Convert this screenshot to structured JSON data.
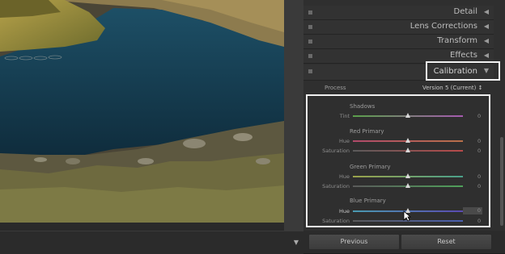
{
  "panel_sections": [
    {
      "title": "Detail"
    },
    {
      "title": "Lens Corrections"
    },
    {
      "title": "Transform"
    },
    {
      "title": "Effects"
    }
  ],
  "calibration": {
    "title": "Calibration",
    "process_label": "Process",
    "process_value": "Version 5 (Current) ↕",
    "shadows_title": "Shadows",
    "red_title": "Red Primary",
    "green_title": "Green Primary",
    "blue_title": "Blue Primary",
    "sliders": [
      {
        "label": "Tint",
        "value": "0",
        "level": 0.5
      },
      {
        "label": "Hue",
        "value": "0",
        "level": 0.5
      },
      {
        "label": "Saturation",
        "value": "0",
        "level": 0.5
      },
      {
        "label": "Hue",
        "value": "0",
        "level": 0.5
      },
      {
        "label": "Saturation",
        "value": "0",
        "level": 0.5
      },
      {
        "label": "Hue",
        "value": "0",
        "level": 0.5
      },
      {
        "label": "Saturation",
        "value": "0",
        "level": 0.5
      }
    ]
  },
  "buttons": {
    "previous": "Previous",
    "reset": "Reset"
  },
  "colors": {
    "panel_bg": "#2f2f2f",
    "highlight": "#f0f0f0",
    "red_track": "#b34a4a",
    "green_track": "#4f9a5a",
    "blue_track": "#4a5fb0",
    "tint_track": "#6e9a58"
  }
}
